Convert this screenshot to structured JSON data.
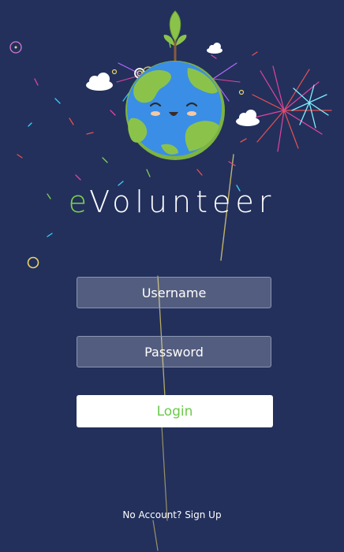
{
  "app": {
    "brand_prefix": "e",
    "brand_rest": "Volunteer"
  },
  "form": {
    "username_placeholder": "Username",
    "password_placeholder": "Password",
    "login_label": "Login",
    "signup_label": "No Account? Sign Up"
  },
  "colors": {
    "background": "#23305c",
    "accent_green": "#7ed34a",
    "login_text": "#6cc94b",
    "field_border": "#8b94b3",
    "earth_ocean": "#3a8ee6",
    "earth_land": "#8bc34a"
  },
  "icons": {
    "mascot": "smiling-earth-with-sprout-icon",
    "clouds": "cloud-icon",
    "fireworks": "firework-burst-icon"
  }
}
